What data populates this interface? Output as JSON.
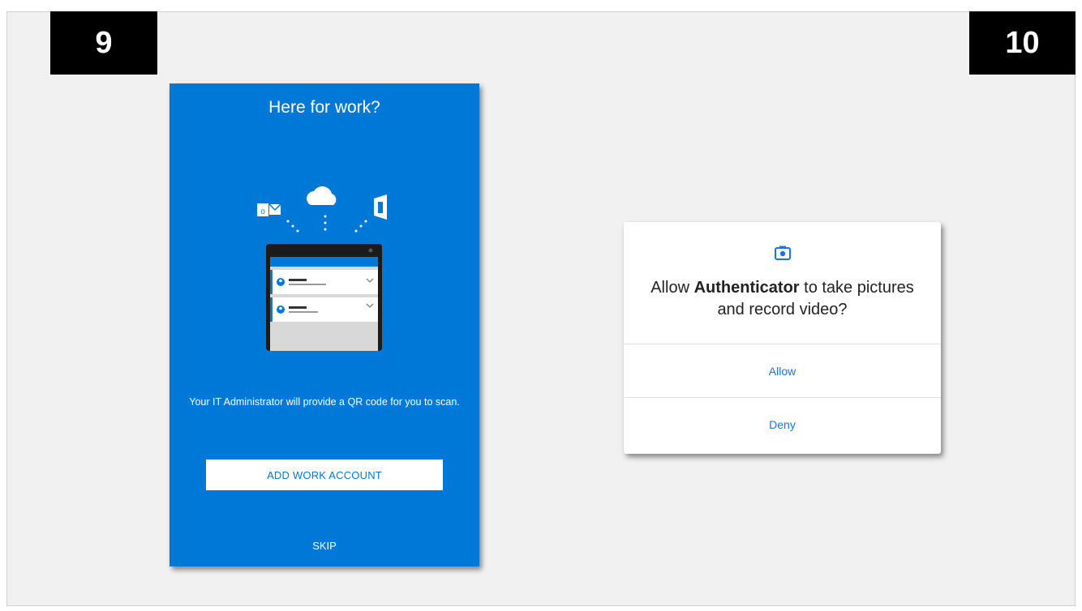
{
  "badges": {
    "left": "9",
    "right": "10"
  },
  "onboarding": {
    "title": "Here for work?",
    "description": "Your IT Administrator will provide a QR code for you to scan.",
    "add_button": "ADD WORK ACCOUNT",
    "skip_button": "SKIP",
    "background": "#0078d7"
  },
  "permission_dialog": {
    "message_prefix": "Allow ",
    "app_name": "Authenticator",
    "message_suffix": " to take pictures and record video?",
    "allow_label": "Allow",
    "deny_label": "Deny",
    "accent": "#1a73e8"
  },
  "icons": [
    "outlook-icon",
    "onedrive-cloud-icon",
    "office-icon",
    "camera-icon",
    "person-icon",
    "chevron-down-icon"
  ]
}
